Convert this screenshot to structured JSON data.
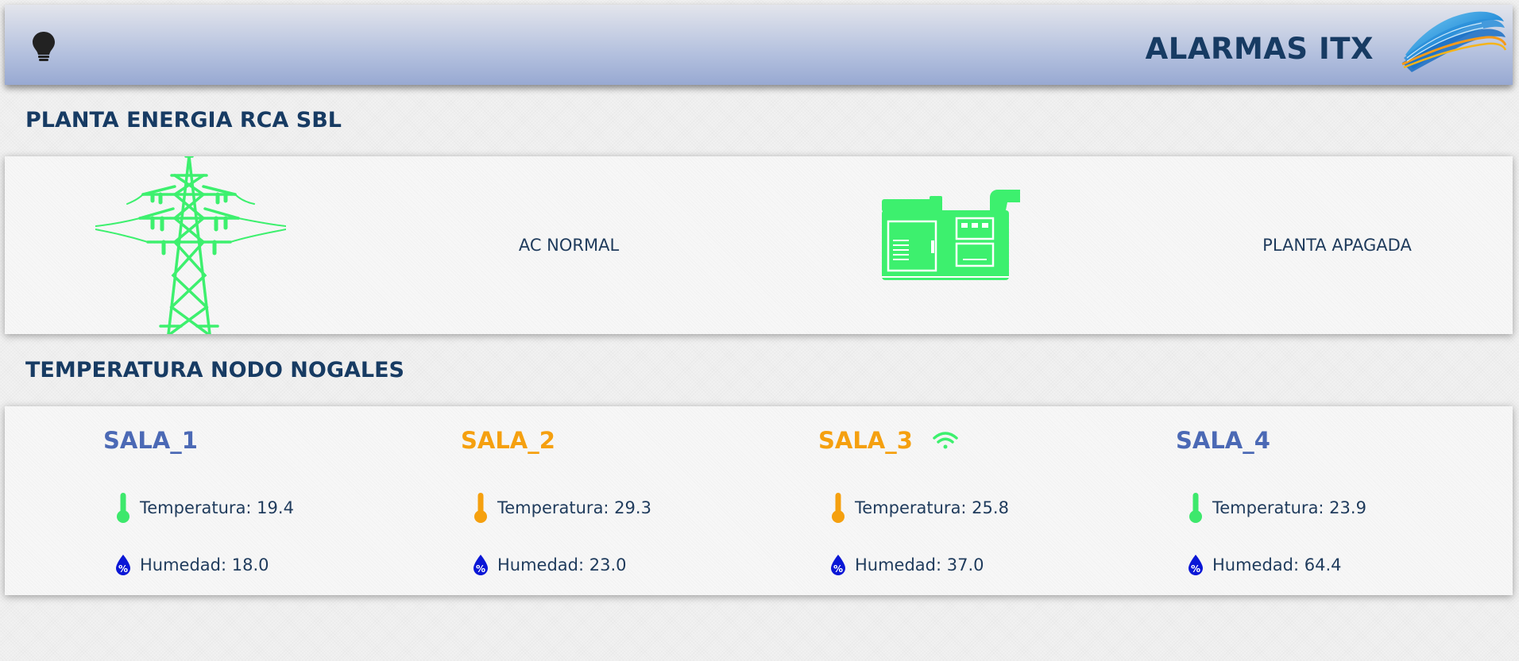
{
  "header": {
    "title": "ALARMAS ITX",
    "icons": {
      "left": "lightbulb-icon",
      "right": "brand-logo"
    }
  },
  "planta": {
    "title": "PLANTA ENERGIA RCA SBL",
    "ac_status": "AC NORMAL",
    "generator_status": "PLANTA APAGADA",
    "icons": [
      "power-tower-icon",
      "generator-icon"
    ]
  },
  "temperatura": {
    "title": "TEMPERATURA NODO NOGALES",
    "salas": [
      {
        "name": "SALA_1",
        "temp_text": "Temperatura: 19.4",
        "hum_text": "Humedad: 18.0",
        "name_color": "#4b69b5",
        "temp_color": "#3de86c",
        "wifi": false
      },
      {
        "name": "SALA_2",
        "temp_text": "Temperatura: 29.3",
        "hum_text": "Humedad: 23.0",
        "name_color": "#f5a00f",
        "temp_color": "#f5a00f",
        "wifi": false
      },
      {
        "name": "SALA_3",
        "temp_text": "Temperatura: 25.8",
        "hum_text": "Humedad: 37.0",
        "name_color": "#f5a00f",
        "temp_color": "#f5a00f",
        "wifi": true
      },
      {
        "name": "SALA_4",
        "temp_text": "Temperatura: 23.9",
        "hum_text": "Humedad: 64.4",
        "name_color": "#4b69b5",
        "temp_color": "#3de86c",
        "wifi": false
      }
    ]
  },
  "colors": {
    "title_navy": "#173b63",
    "ok_green": "#3df06e",
    "warn_orange": "#f5a00f",
    "humidity_blue": "#0a17d6"
  }
}
